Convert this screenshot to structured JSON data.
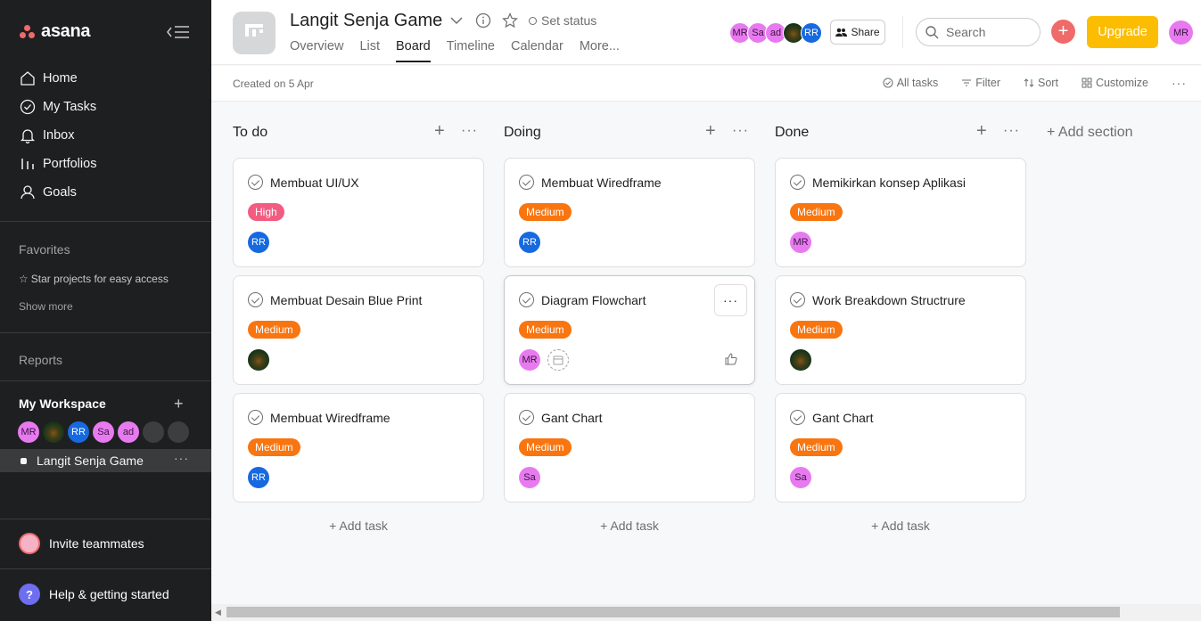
{
  "brand": {
    "logo_text": "asana"
  },
  "sidebar": {
    "nav": [
      {
        "label": "Home",
        "icon": "home-icon"
      },
      {
        "label": "My Tasks",
        "icon": "check-circle-icon"
      },
      {
        "label": "Inbox",
        "icon": "bell-icon"
      },
      {
        "label": "Portfolios",
        "icon": "bar-chart-icon"
      },
      {
        "label": "Goals",
        "icon": "person-icon"
      }
    ],
    "favorites_title": "Favorites",
    "favorites_hint": "Star projects for easy access",
    "show_more": "Show more",
    "reports": "Reports",
    "workspace_title": "My Workspace",
    "workspace_avatars": [
      "MR",
      "",
      "RR",
      "Sa",
      "ad",
      "",
      ""
    ],
    "project": "Langit Senja Game",
    "invite": "Invite teammates",
    "help": "Help & getting started",
    "help_icon_glyph": "?"
  },
  "header": {
    "title": "Langit Senja Game",
    "set_status": "Set status",
    "tabs": [
      "Overview",
      "List",
      "Board",
      "Timeline",
      "Calendar",
      "More..."
    ],
    "active_tab": "Board",
    "member_avatars": [
      "MR",
      "Sa",
      "ad",
      "",
      "RR"
    ],
    "share": "Share",
    "search_placeholder": "Search",
    "plus_glyph": "+",
    "upgrade": "Upgrade",
    "me": "MR"
  },
  "toolbar": {
    "created": "Created on 5 Apr",
    "all_tasks": "All tasks",
    "filter": "Filter",
    "sort": "Sort",
    "customize": "Customize"
  },
  "board": {
    "columns": [
      {
        "title": "To do",
        "cards": [
          {
            "title": "Membuat UI/UX",
            "tag": "High",
            "assignee": "RR"
          },
          {
            "title": "Membuat Desain Blue Print",
            "tag": "Medium",
            "assignee": ""
          },
          {
            "title": "Membuat Wiredframe",
            "tag": "Medium",
            "assignee": "RR"
          }
        ]
      },
      {
        "title": "Doing",
        "cards": [
          {
            "title": "Membuat Wiredframe",
            "tag": "Medium",
            "assignee": "RR"
          },
          {
            "title": "Diagram Flowchart",
            "tag": "Medium",
            "assignee": "MR"
          },
          {
            "title": "Gant Chart",
            "tag": "Medium",
            "assignee": "Sa"
          }
        ]
      },
      {
        "title": "Done",
        "cards": [
          {
            "title": "Memikirkan konsep Aplikasi",
            "tag": "Medium",
            "assignee": "MR"
          },
          {
            "title": "Work Breakdown Structrure",
            "tag": "Medium",
            "assignee": ""
          },
          {
            "title": "Gant Chart",
            "tag": "Medium",
            "assignee": "Sa"
          }
        ]
      }
    ],
    "add_task": "Add task",
    "add_task_glyph": "+",
    "add_section": "+ Add section"
  },
  "colors": {
    "sidebar_bg": "#1e1f21",
    "tag_high": "#f25c81",
    "tag_medium": "#f87510",
    "avatar_pink": "#e87af0",
    "avatar_blue": "#1769e0",
    "upgrade": "#fcbd01",
    "plus_button": "#f06a6a"
  }
}
